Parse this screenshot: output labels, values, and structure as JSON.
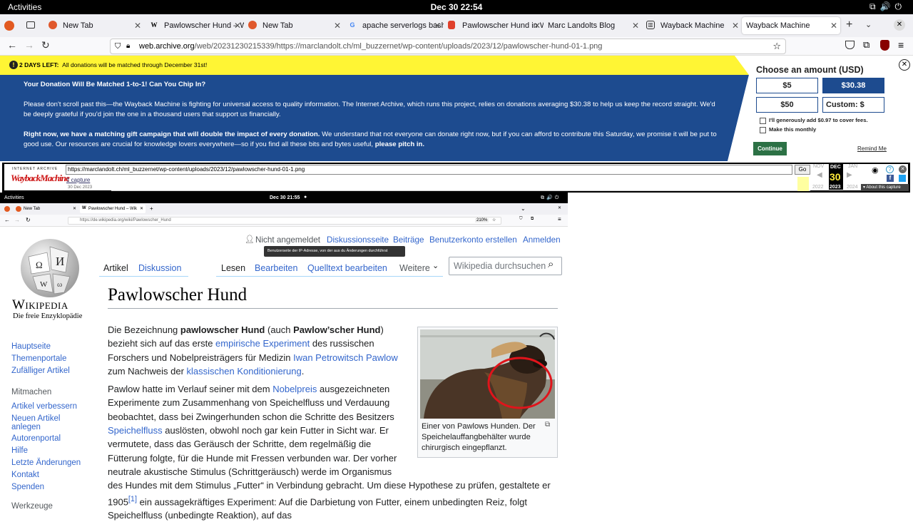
{
  "system": {
    "activities": "Activities",
    "clock": "Dec 30  22:54"
  },
  "tabs": [
    {
      "label": "New Tab",
      "color": "#e0582c"
    },
    {
      "label": "Pawlowscher Hund – Wikipedia",
      "color": "#ffffff"
    },
    {
      "label": "New Tab",
      "color": "#e0582c"
    },
    {
      "label": "apache serverlogs bash",
      "color": "#4285f4"
    },
    {
      "label": "Pawlowscher Hund in W",
      "color": "#e0402c"
    },
    {
      "label": "Marc Landolts Blog",
      "color": "#ffffff"
    },
    {
      "label": "Wayback Machine",
      "color": "#333333"
    },
    {
      "label": "Wayback Machine",
      "color": "#ffffff"
    }
  ],
  "url": {
    "domain": "web.archive.org",
    "path": "/web/20231230215339/https://marclandolt.ch/ml_buzzernet/wp-content/uploads/2023/12/pawlowscher-hund-01-1.png"
  },
  "banner": {
    "days_left": "2 DAYS LEFT:",
    "days_left_msg": "All donations will be matched through December 31st!",
    "heading": "Your Donation Will Be Matched 1-to-1! Can You Chip In?",
    "para1": "Please don't scroll past this—the Wayback Machine is fighting for universal access to quality information. The Internet Archive, which runs this project, relies on donations averaging $30.38 to help us keep the record straight. We'd be deeply grateful if you'd join the one in a thousand users that support us financially.",
    "para2_bold": "Right now, we have a matching gift campaign that will double the impact of every donation.",
    "para2": " We understand that not everyone can donate right now, but if you can afford to contribute this Saturday, we promise it will be put to good use. Our resources are crucial for knowledge lovers everywhere—so if you find all these bits and bytes useful,",
    "para2_end": "please pitch in.",
    "choose": "Choose an amount (USD)",
    "amt1": "$5",
    "amt2": "$30.38",
    "amt3": "$50",
    "custom": "Custom: $",
    "fee": "I'll generously add $0.97 to cover fees.",
    "monthly": "Make this monthly",
    "continue": "Continue",
    "remind": "Remind Me"
  },
  "wayback": {
    "logo_top": "INTERNET ARCHIVE",
    "logo": "WaybackMachine",
    "url": "https://marclandolt.ch/ml_buzzernet/wp-content/uploads/2023/12/pawlowscher-hund-01-1.png",
    "go": "Go",
    "captures": "1 capture",
    "date": "30 Dec 2023",
    "prev_month": "NOV",
    "month": "DEC",
    "day": "30",
    "next_month": "JAN",
    "prev_year": "2022",
    "year": "2023",
    "next_year": "2024",
    "about": "About this capture"
  },
  "inner": {
    "activities": "Activities",
    "clock": "Dec 30  21:55",
    "tab1": "New Tab",
    "tab2": "Pawlowscher Hund – Wik",
    "url_domain": "https://de.wikipedia.org",
    "url_path": "/wiki/Pawlowscher_Hund",
    "zoom": "210%"
  },
  "wiki": {
    "not_logged": "Nicht angemeldet",
    "talk": "Diskussionsseite",
    "contribs": "Beiträge",
    "create": "Benutzerkonto erstellen",
    "login": "Anmelden",
    "tooltip": "Benutzerseite der IP-Adresse, von der aus du Änderungen durchführst",
    "wordmark": "Wikipedia",
    "tagline": "Die freie Enzyklopädie",
    "tab_article": "Artikel",
    "tab_talk": "Diskussion",
    "tab_read": "Lesen",
    "tab_edit": "Bearbeiten",
    "tab_source": "Quelltext bearbeiten",
    "tab_more": "Weitere",
    "search_placeholder": "Wikipedia durchsuchen",
    "title": "Pawlowscher Hund",
    "nav": [
      "Hauptseite",
      "Themenportale",
      "Zufälliger Artikel"
    ],
    "mitmachen": "Mitmachen",
    "mitmachen_links": [
      "Artikel verbessern",
      "Neuen Artikel anlegen",
      "Autorenportal",
      "Hilfe",
      "Letzte Änderungen",
      "Kontakt",
      "Spenden"
    ],
    "werkzeuge": "Werkzeuge",
    "caption": "Einer von Pawlows Hunden. Der Speichelauffangbehälter wurde chirurgisch eingepflanzt.",
    "p1": [
      "Die Bezeichnung ",
      "pawlowscher Hund",
      " (auch ",
      "Pawlow’scher Hund",
      ") bezieht sich auf das erste ",
      "empirische Experiment",
      " des russischen Forschers und Nobelpreisträgers für Medizin ",
      "Iwan Petrowitsch Pawlow",
      " zum Nachweis der ",
      "klassischen Konditionierung",
      "."
    ],
    "p2": [
      "Pawlow hatte im Verlauf seiner mit dem ",
      "Nobelpreis",
      " ausgezeichneten Experimente zum Zusammenhang von Speichelfluss und Verdauung beobachtet, dass bei Zwingerhunden schon die Schritte des Besitzers ",
      "Speichelfluss",
      " auslösten, obwohl noch gar kein Futter in Sicht war. Er vermutete, dass das Geräusch der Schritte, dem regelmäßig die Fütterung folgte, für die Hunde mit Fressen verbunden war. Der vorher neutrale akustische Stimulus (Schrittgeräusch) werde im Organismus des Hundes mit dem Stimulus „Futter“ in Verbindung gebracht. Um diese Hypothese zu prüfen, gestaltete er 1905",
      "[1]",
      " ein aussagekräftiges Experiment: Auf die Darbietung von Futter, einem unbedingten Reiz, folgt Speichelfluss (unbedingte Reaktion), auf das"
    ]
  }
}
